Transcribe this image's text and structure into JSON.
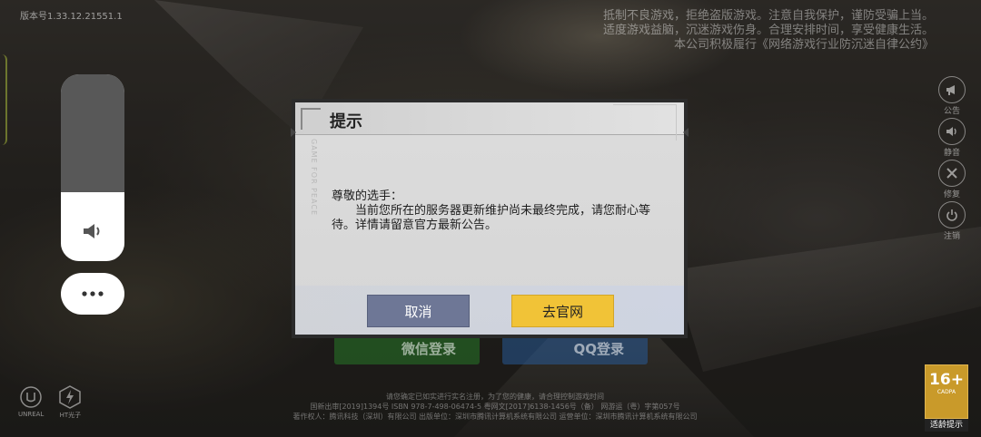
{
  "version_text": "版本号1.33.12.21551.1",
  "health_notice": [
    "抵制不良游戏，拒绝盗版游戏。注意自我保护，谨防受骗上当。",
    "适度游戏益脑，沉迷游戏伤身。合理安排时间，享受健康生活。",
    "本公司积极履行《网络游戏行业防沉迷自律公约》"
  ],
  "side_buttons": [
    {
      "label": "公告",
      "icon": "megaphone-icon"
    },
    {
      "label": "静音",
      "icon": "speaker-icon"
    },
    {
      "label": "修复",
      "icon": "wrench-icon"
    },
    {
      "label": "注销",
      "icon": "power-icon"
    }
  ],
  "volume": {
    "level": 0.37,
    "icon": "speaker-icon"
  },
  "more_button": {
    "icon": "more-dots-icon"
  },
  "login": {
    "wechat_label": "微信登录",
    "qq_label": "QQ登录"
  },
  "dialog": {
    "title": "提示",
    "side_text": "GAME FOR PEACE",
    "greeting": "尊敬的选手：",
    "message": "当前您所在的服务器更新维护尚未最终完成，请您耐心等待。详情请留意官方最新公告。",
    "cancel_label": "取消",
    "website_label": "去官网"
  },
  "logos": [
    {
      "label": "UNREAL",
      "icon": "unreal-logo-icon"
    },
    {
      "label": "HT光子",
      "icon": "lightspeed-logo-icon"
    }
  ],
  "legal": [
    "请您确定已如实进行实名注册，为了您的健康，请合理控制游戏时间",
    "国新出审[2019]1394号  ISBN 978-7-498-06474-5  粤网文[2017]6138-1456号（备）  网游运（粤）字第057号",
    "著作权人：腾讯科技（深圳）有限公司   出版单位：深圳市腾讯计算机系统有限公司   运营单位：深圳市腾讯计算机系统有限公司"
  ],
  "age_rating": {
    "number": "16+",
    "sub": "CADPA",
    "label": "适龄提示"
  },
  "colors": {
    "cancel_button": "#6e7796",
    "website_button": "#f1c337",
    "dialog_bg": "#dcdcdc"
  }
}
